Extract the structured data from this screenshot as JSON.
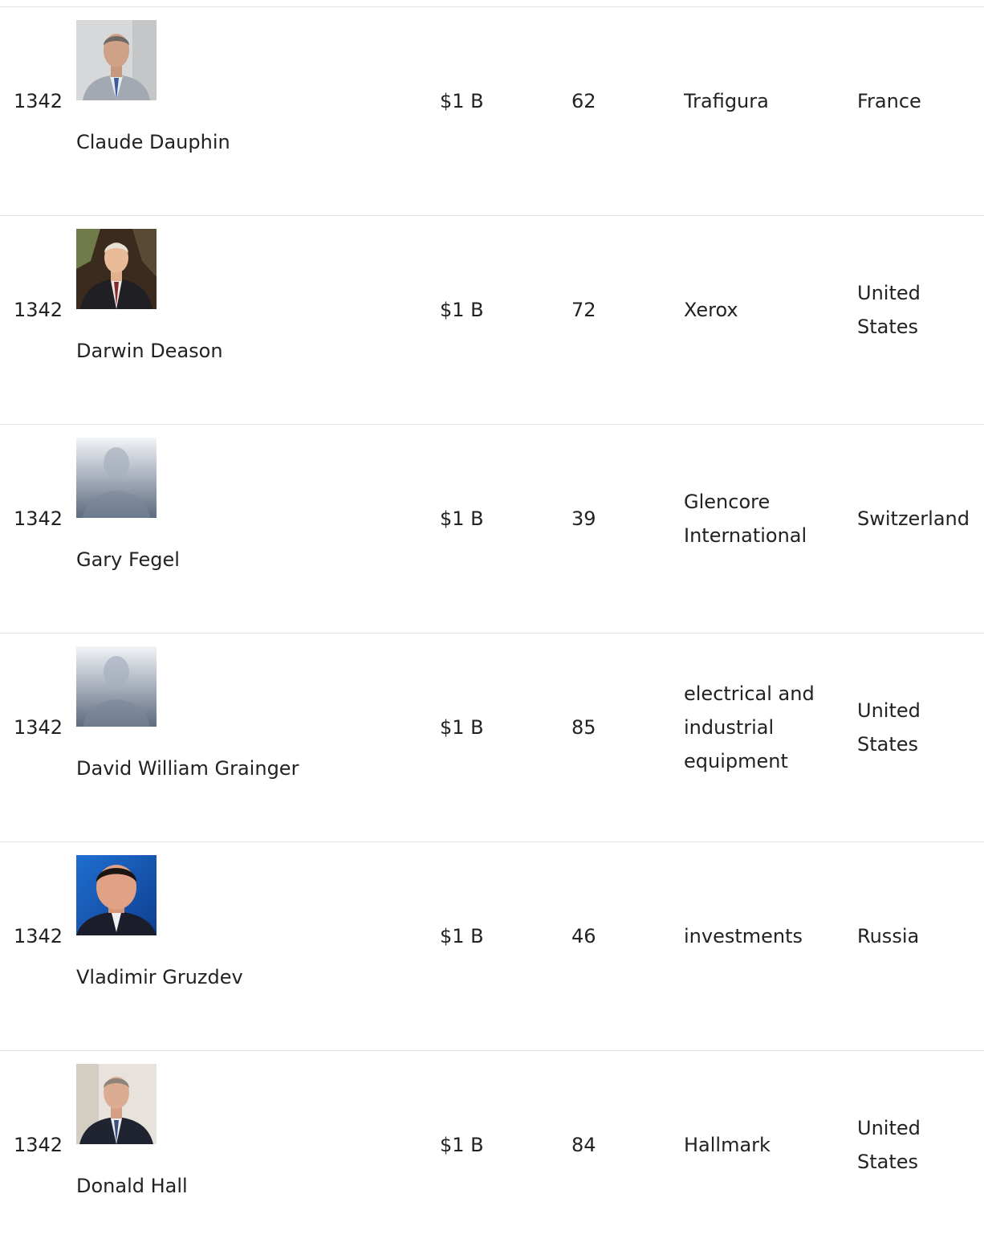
{
  "rows": [
    {
      "rank": "1342",
      "name": "Claude Dauphin",
      "worth": "$1 B",
      "age": "62",
      "source": "Trafigura",
      "country": "France",
      "photo": "claude-dauphin-photo"
    },
    {
      "rank": "1342",
      "name": "Darwin Deason",
      "worth": "$1 B",
      "age": "72",
      "source": "Xerox",
      "country": "United States",
      "photo": "darwin-deason-photo"
    },
    {
      "rank": "1342",
      "name": "Gary Fegel",
      "worth": "$1 B",
      "age": "39",
      "source": "Glencore International",
      "country": "Switzerland",
      "photo": "placeholder-avatar"
    },
    {
      "rank": "1342",
      "name": "David William Grainger",
      "worth": "$1 B",
      "age": "85",
      "source": "electrical and industrial equipment",
      "country": "United States",
      "photo": "placeholder-avatar"
    },
    {
      "rank": "1342",
      "name": "Vladimir Gruzdev",
      "worth": "$1 B",
      "age": "46",
      "source": "investments",
      "country": "Russia",
      "photo": "vladimir-gruzdev-photo"
    },
    {
      "rank": "1342",
      "name": "Donald Hall",
      "worth": "$1 B",
      "age": "84",
      "source": "Hallmark",
      "country": "United States",
      "photo": "donald-hall-photo"
    }
  ],
  "colors": {
    "text": "#222222",
    "divider": "#e4e4e4",
    "placeholder_top": "#f2f4f7",
    "placeholder_bottom": "#5d6b80"
  }
}
